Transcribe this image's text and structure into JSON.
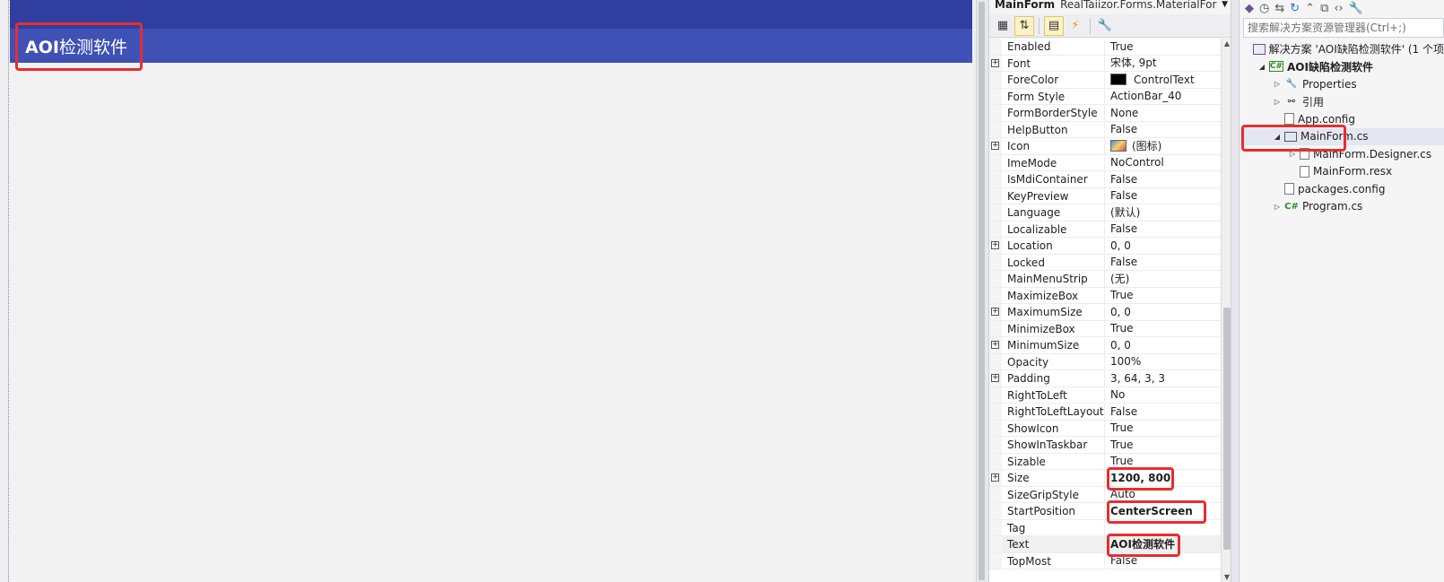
{
  "designer": {
    "form_title_ascii": "AOI",
    "form_title_cjk": "检测软件"
  },
  "properties": {
    "object_name": "MainForm",
    "object_type": "RealTaiizor.Forms.MaterialFor",
    "rows": [
      {
        "name": "Enabled",
        "value": "True",
        "expandable": false
      },
      {
        "name": "Font",
        "value": "宋体, 9pt",
        "expandable": true
      },
      {
        "name": "ForeColor",
        "value": "ControlText",
        "expandable": false,
        "swatch": "#000000"
      },
      {
        "name": "Form Style",
        "value": "ActionBar_40",
        "expandable": false
      },
      {
        "name": "FormBorderStyle",
        "value": "None",
        "expandable": false
      },
      {
        "name": "HelpButton",
        "value": "False",
        "expandable": false
      },
      {
        "name": "Icon",
        "value": "(图标)",
        "expandable": true,
        "thumb": true
      },
      {
        "name": "ImeMode",
        "value": "NoControl",
        "expandable": false
      },
      {
        "name": "IsMdiContainer",
        "value": "False",
        "expandable": false
      },
      {
        "name": "KeyPreview",
        "value": "False",
        "expandable": false
      },
      {
        "name": "Language",
        "value": "(默认)",
        "expandable": false
      },
      {
        "name": "Localizable",
        "value": "False",
        "expandable": false
      },
      {
        "name": "Location",
        "value": "0, 0",
        "expandable": true
      },
      {
        "name": "Locked",
        "value": "False",
        "expandable": false
      },
      {
        "name": "MainMenuStrip",
        "value": "(无)",
        "expandable": false
      },
      {
        "name": "MaximizeBox",
        "value": "True",
        "expandable": false
      },
      {
        "name": "MaximumSize",
        "value": "0, 0",
        "expandable": true
      },
      {
        "name": "MinimizeBox",
        "value": "True",
        "expandable": false
      },
      {
        "name": "MinimumSize",
        "value": "0, 0",
        "expandable": true
      },
      {
        "name": "Opacity",
        "value": "100%",
        "expandable": false
      },
      {
        "name": "Padding",
        "value": "3, 64, 3, 3",
        "expandable": true
      },
      {
        "name": "RightToLeft",
        "value": "No",
        "expandable": false
      },
      {
        "name": "RightToLeftLayout",
        "value": "False",
        "expandable": false
      },
      {
        "name": "ShowIcon",
        "value": "True",
        "expandable": false
      },
      {
        "name": "ShowInTaskbar",
        "value": "True",
        "expandable": false
      },
      {
        "name": "Sizable",
        "value": "True",
        "expandable": false
      },
      {
        "name": "Size",
        "value": "1200, 800",
        "expandable": true,
        "bold": true,
        "highlight": true
      },
      {
        "name": "SizeGripStyle",
        "value": "Auto",
        "expandable": false
      },
      {
        "name": "StartPosition",
        "value": "CenterScreen",
        "expandable": false,
        "bold": true,
        "highlight": true
      },
      {
        "name": "Tag",
        "value": "",
        "expandable": false
      },
      {
        "name": "Text",
        "value": "AOI检测软件",
        "expandable": false,
        "bold": true,
        "highlight": true,
        "selected": true
      },
      {
        "name": "TopMost",
        "value": "False",
        "expandable": false
      }
    ]
  },
  "solution_explorer": {
    "search_placeholder": "搜索解决方案资源管理器(Ctrl+;)",
    "items": [
      {
        "label": "解决方案 'AOI缺陷检测软件' (1 个项",
        "icon": "solution-icon",
        "indent": 0,
        "arrow": "",
        "bold": false
      },
      {
        "label": "AOI缺陷检测软件",
        "icon": "csharp-project-icon",
        "indent": 1,
        "arrow": "◢",
        "bold": true
      },
      {
        "label": "Properties",
        "icon": "wrench-icon",
        "indent": 2,
        "arrow": "▷",
        "bold": false
      },
      {
        "label": "引用",
        "icon": "references-icon",
        "indent": 2,
        "arrow": "▷",
        "bold": false
      },
      {
        "label": "App.config",
        "icon": "config-file-icon",
        "indent": 2,
        "arrow": "",
        "bold": false
      },
      {
        "label": "MainForm.cs",
        "icon": "form-icon",
        "indent": 2,
        "arrow": "◢",
        "bold": false,
        "selected": true
      },
      {
        "label": "MainForm.Designer.cs",
        "icon": "cs-file-icon",
        "indent": 3,
        "arrow": "▷",
        "bold": false
      },
      {
        "label": "MainForm.resx",
        "icon": "resx-file-icon",
        "indent": 3,
        "arrow": "",
        "bold": false
      },
      {
        "label": "packages.config",
        "icon": "config-file-icon",
        "indent": 2,
        "arrow": "",
        "bold": false
      },
      {
        "label": "Program.cs",
        "icon": "csharp-file-icon",
        "indent": 2,
        "arrow": "▷",
        "bold": false
      }
    ]
  },
  "colors": {
    "form_topbar": "#303f9f",
    "form_actionbar": "#3f51b5",
    "highlight_red": "#e62e2e"
  }
}
